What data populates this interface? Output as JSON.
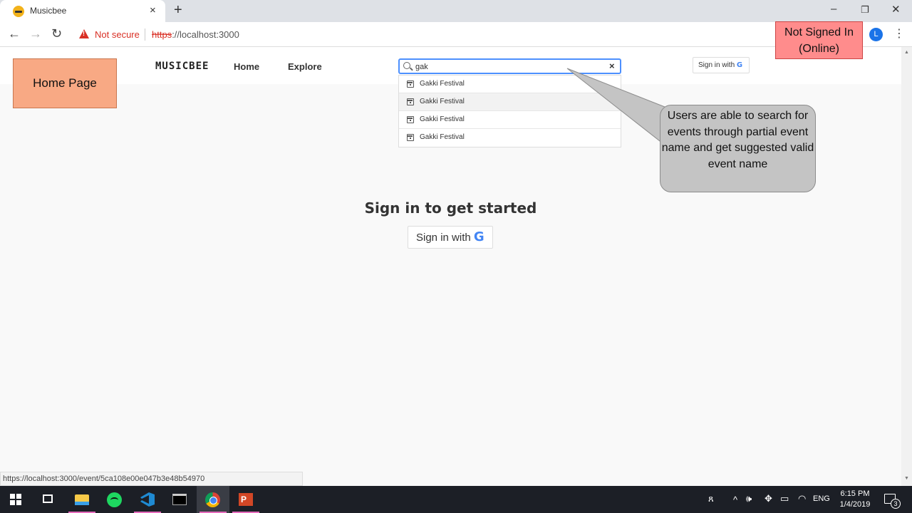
{
  "browser": {
    "tab_title": "Musicbee",
    "tab_close": "×",
    "new_tab": "+",
    "win_minimize": "–",
    "win_restore": "❐",
    "win_close": "✕",
    "nav_back": "←",
    "nav_forward": "→",
    "nav_reload": "↻",
    "security_label": "Not secure",
    "url_scheme": "https",
    "url_rest": "://localhost:3000",
    "profile_initial": "L",
    "menu": "⋮",
    "status_url": "https://localhost:3000/event/5ca108e00e047b3e48b54970"
  },
  "annotations": {
    "page_label": "Home Page",
    "auth_state_line1": "Not Signed In",
    "auth_state_line2": "(Online)",
    "callout_text": "Users are able to search for events through partial event name and get suggested valid event name"
  },
  "site": {
    "brand": "MUSICBEE",
    "nav_home": "Home",
    "nav_explore": "Explore",
    "signin_label": "Sign in with",
    "google_glyph": "G"
  },
  "search": {
    "value": "gak",
    "clear": "×",
    "suggestions": [
      {
        "label": "Gakki Festival"
      },
      {
        "label": "Gakki Festival"
      },
      {
        "label": "Gakki Festival"
      },
      {
        "label": "Gakki Festival"
      }
    ]
  },
  "main": {
    "title": "Sign in to get started",
    "signin_label": "Sign in with",
    "google_glyph": "G"
  },
  "taskbar": {
    "language": "ENG",
    "time": "6:15 PM",
    "date": "1/4/2019",
    "notification_count": "3",
    "tray_person": "ጸ",
    "tray_chevron": "^",
    "tray_volume": "🕪",
    "tray_dropbox": "✥",
    "tray_battery": "▭",
    "tray_wifi": "◠"
  },
  "colors": {
    "accent": "#4d90fe",
    "warning": "#d93025",
    "not_signed_box": "#ff8c8c",
    "home_box": "#f8a984",
    "callout": "#c4c4c4"
  }
}
